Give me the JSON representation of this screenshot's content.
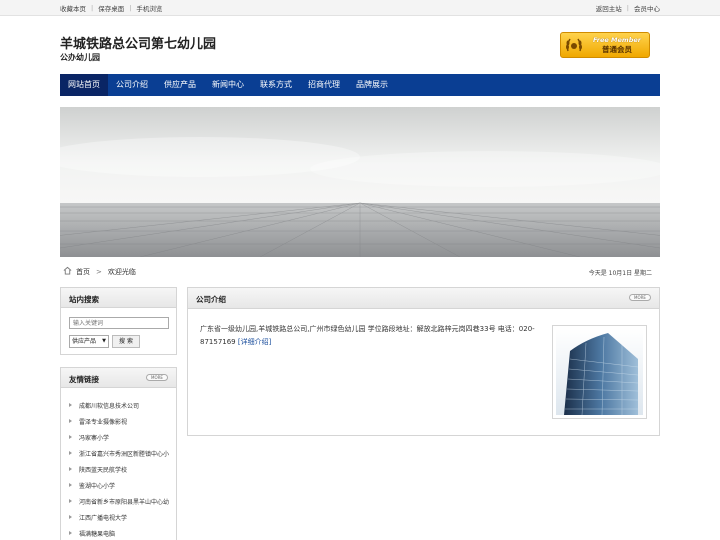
{
  "topbar": {
    "left_links": [
      "收藏本页",
      "保存桌面",
      "手机浏览"
    ],
    "right_links": [
      "返回主站",
      "会员中心"
    ]
  },
  "header": {
    "title": "羊城铁路总公司第七幼儿园",
    "subtitle": "公办幼儿园",
    "badge_en": "Free Member",
    "badge_cn": "普通会员"
  },
  "nav": {
    "items": [
      "网站首页",
      "公司介绍",
      "供应产品",
      "新闻中心",
      "联系方式",
      "招商代理",
      "品牌展示"
    ],
    "active_index": 0
  },
  "breadcrumb": {
    "home": "首页",
    "arrow": ">",
    "current": "欢迎光临",
    "date": "今天是 10月1日 星期二"
  },
  "search": {
    "title": "站内搜索",
    "placeholder": "输入关键词",
    "select_value": "供应产品",
    "button": "搜 索"
  },
  "links": {
    "title": "友情链接",
    "more": "MORE",
    "items": [
      "成都川软信息技术公司",
      "雷泽专业摄像影视",
      "冯家寨小学",
      "浙江省嘉兴市秀洲区新塍镇中心小",
      "陕西蓝天民航学校",
      "鉴湖中心小学",
      "河南省新乡市原阳县黑羊山中心幼",
      "江西广播电视大学",
      "福满糖果电脑"
    ]
  },
  "intro": {
    "title": "公司介绍",
    "more": "MORE",
    "text": "广东省一级幼儿园,羊城铁路总公司,广州市绿色幼儿园 学位路段地址：解放北路梓元岗四巷33号 电话：020-87157169",
    "link": "[详细介绍]"
  },
  "colors": {
    "nav_bg": "#0a3e93",
    "nav_active": "#0a2565",
    "badge_gold": "#f0a800",
    "link_blue": "#1a4d9c"
  }
}
